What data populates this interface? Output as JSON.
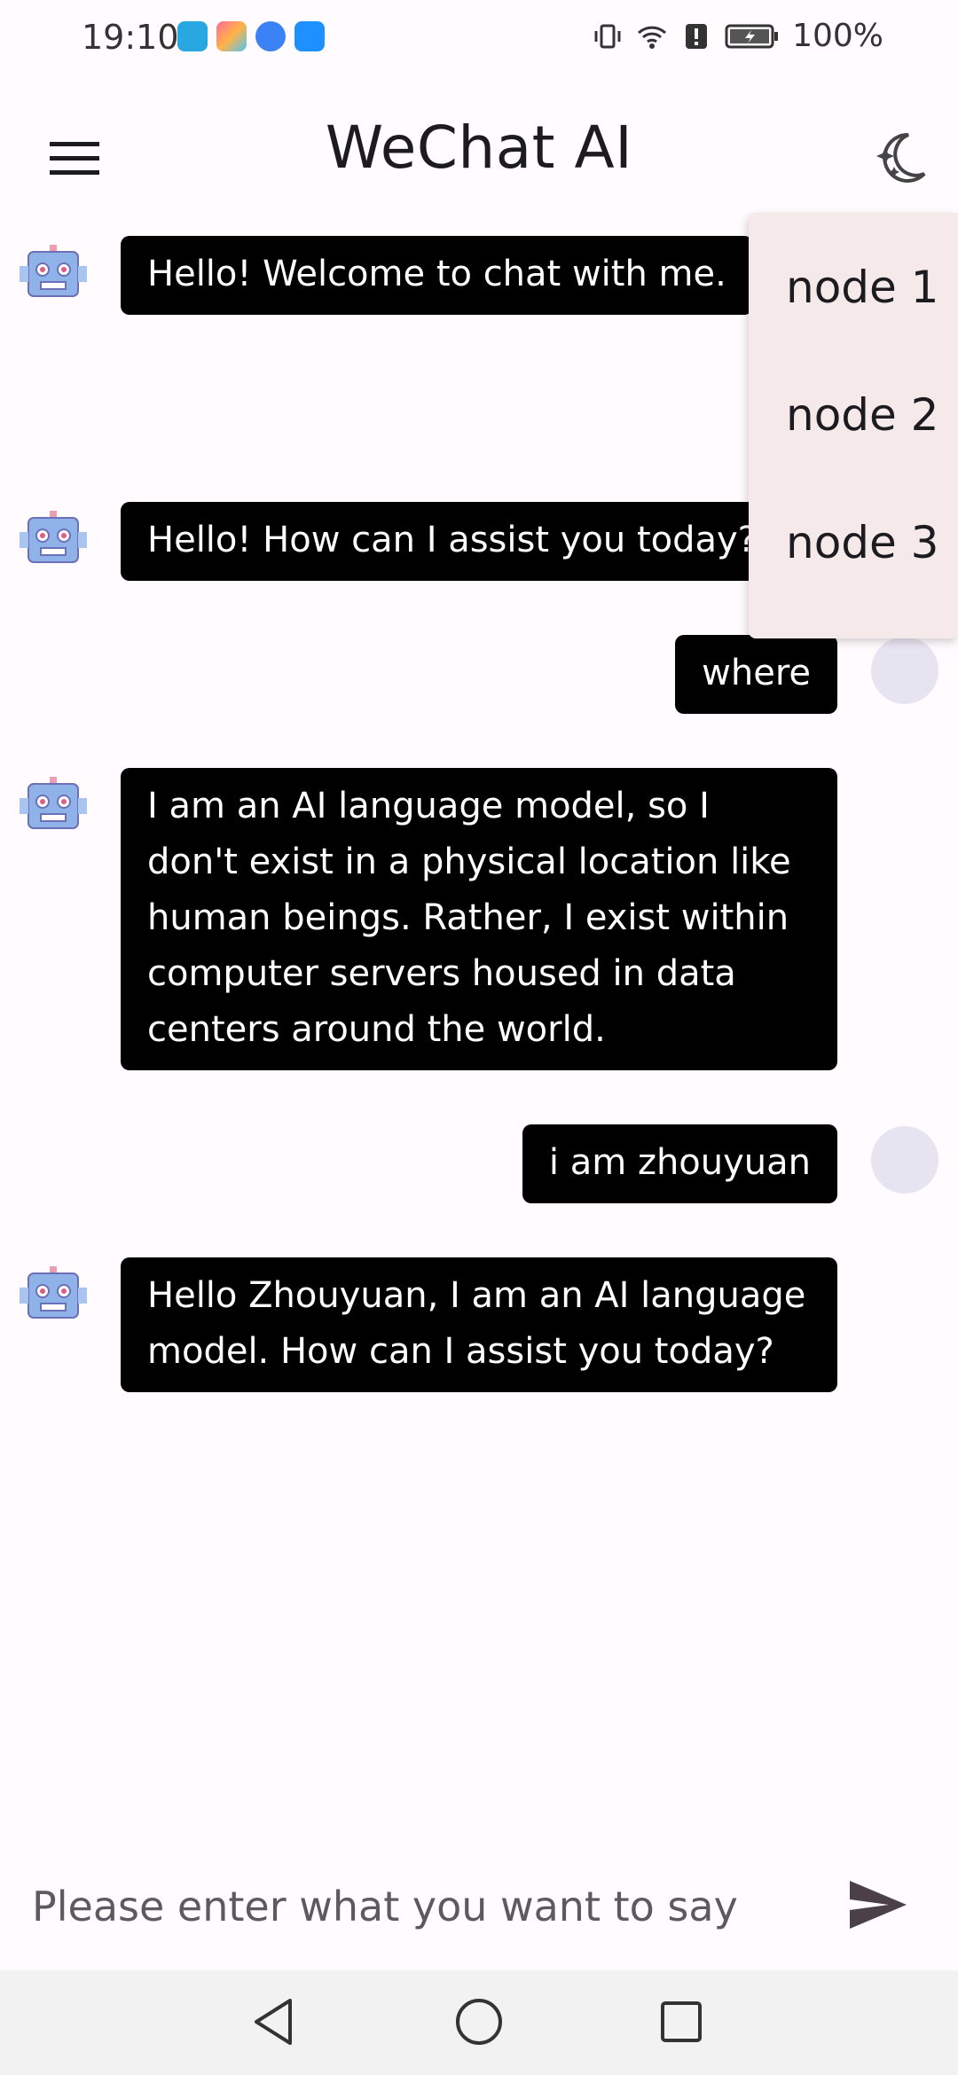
{
  "status_bar": {
    "time": "19:10",
    "battery": "100%"
  },
  "app_bar": {
    "title": "WeChat AI",
    "menu_icon": "hamburger-menu-icon",
    "theme_icon": "dark-mode-icon"
  },
  "node_menu": {
    "items": [
      "node 1",
      "node 2",
      "node 3"
    ]
  },
  "messages": [
    {
      "sender": "bot",
      "text": "Hello! Welcome to chat with me."
    },
    {
      "sender": "bot",
      "text": "Hello! How can I assist you today?"
    },
    {
      "sender": "user",
      "text": "where"
    },
    {
      "sender": "bot",
      "text": "I am an AI language model, so I don't exist in a physical location like human beings. Rather, I exist within computer servers housed in data centers around the world."
    },
    {
      "sender": "user",
      "text": "i am zhouyuan"
    },
    {
      "sender": "bot",
      "text": "Hello Zhouyuan, I am an AI language model. How can I assist you today?"
    }
  ],
  "input": {
    "placeholder": "Please enter what you want to say",
    "value": ""
  },
  "colors": {
    "bubble": "#000000",
    "menu_bg": "#f6e9ea",
    "page_bg": "#fffbfe"
  }
}
